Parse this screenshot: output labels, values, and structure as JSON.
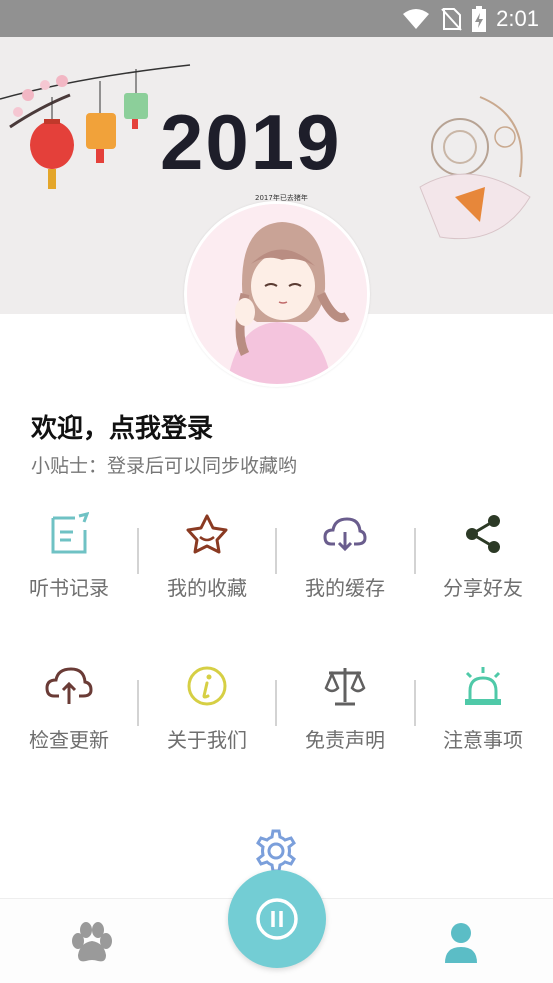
{
  "status_bar": {
    "time": "2:01",
    "icons": [
      "wifi-icon",
      "no-sim-icon",
      "battery-charging-icon"
    ]
  },
  "banner": {
    "year_text": "2019",
    "sub_text": "2017年已去猪年"
  },
  "profile": {
    "welcome": "欢迎，点我登录",
    "tip": "小贴士：登录后可以同步收藏哟"
  },
  "menu": {
    "row1": [
      {
        "label": "听书记录",
        "icon": "history-note-icon",
        "color": "#6fc2c4"
      },
      {
        "label": "我的收藏",
        "icon": "star-favorite-icon",
        "color": "#8a3a22"
      },
      {
        "label": "我的缓存",
        "icon": "cloud-download-icon",
        "color": "#6a5d8d"
      },
      {
        "label": "分享好友",
        "icon": "share-icon",
        "color": "#2c3a26"
      }
    ],
    "row2": [
      {
        "label": "检查更新",
        "icon": "cloud-upload-icon",
        "color": "#6a3b36"
      },
      {
        "label": "关于我们",
        "icon": "info-icon",
        "color": "#d6cf44"
      },
      {
        "label": "免责声明",
        "icon": "scale-icon",
        "color": "#616060"
      },
      {
        "label": "注意事项",
        "icon": "alarm-light-icon",
        "color": "#4fc9a8"
      }
    ]
  },
  "colors": {
    "accent": "#73cdd4",
    "settings": "#7b9fdb",
    "tab_inactive": "#9a9a9a",
    "tab_active": "#5bbdc6"
  },
  "tabs": [
    {
      "icon": "paw-icon",
      "active": false
    },
    {
      "icon": "user-icon",
      "active": true
    }
  ]
}
